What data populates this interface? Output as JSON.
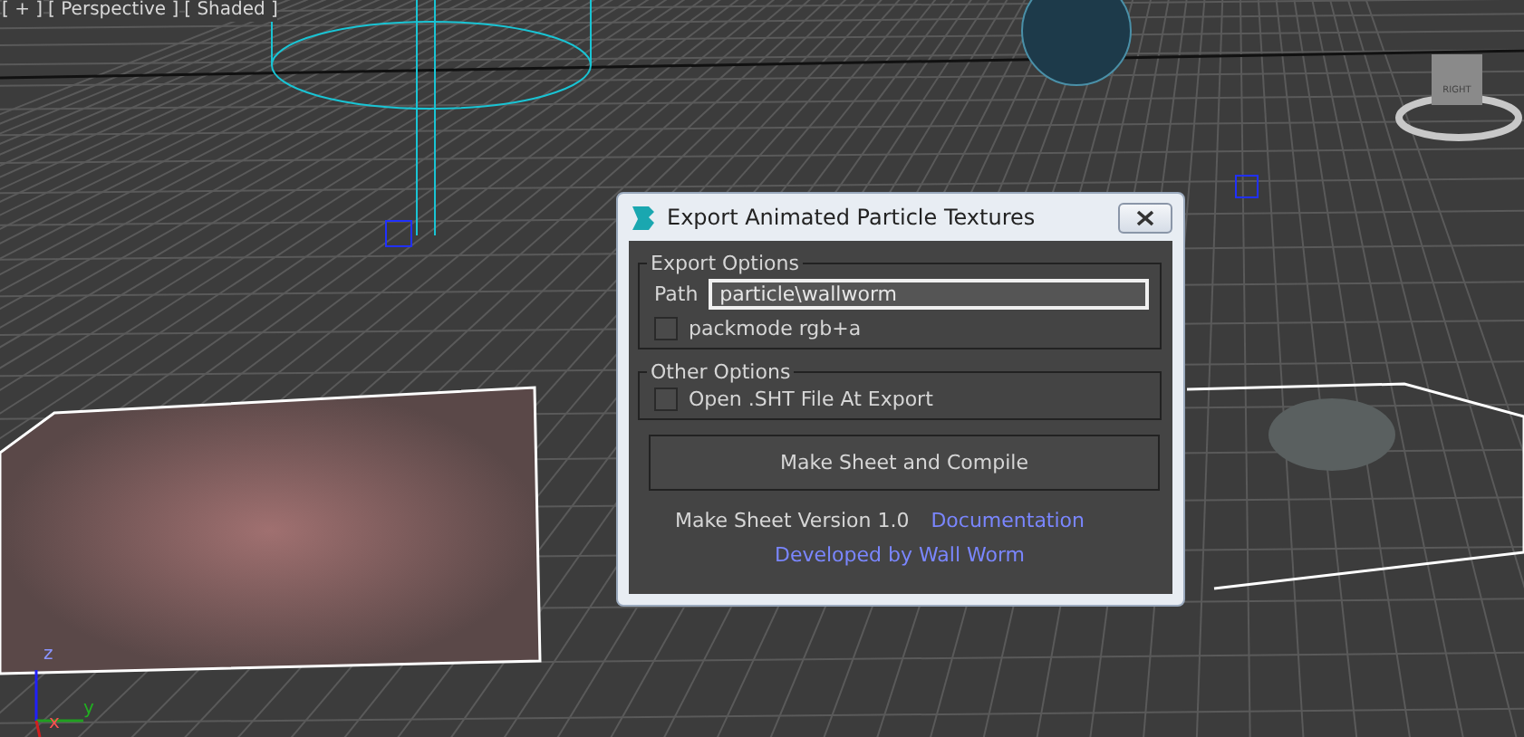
{
  "viewport": {
    "labels": [
      "[ + ]",
      "[ Perspective ]",
      "[ Shaded ]"
    ],
    "viewcube_face": "RIGHT",
    "axes": {
      "z": "z",
      "y": "y",
      "x": "x"
    }
  },
  "dialog": {
    "title": "Export Animated Particle Textures",
    "groups": [
      {
        "title": "Export Options",
        "path": {
          "label": "Path",
          "value": "particle\\wallworm"
        },
        "checkboxes": [
          {
            "label": "packmode rgb+a",
            "checked": false
          }
        ]
      },
      {
        "title": "Other Options",
        "checkboxes": [
          {
            "label": "Open .SHT File At Export",
            "checked": false
          }
        ]
      }
    ],
    "button": "Make Sheet and Compile",
    "version": "Make Sheet Version 1.0",
    "links": [
      "Documentation",
      "Developed by Wall Worm"
    ]
  }
}
